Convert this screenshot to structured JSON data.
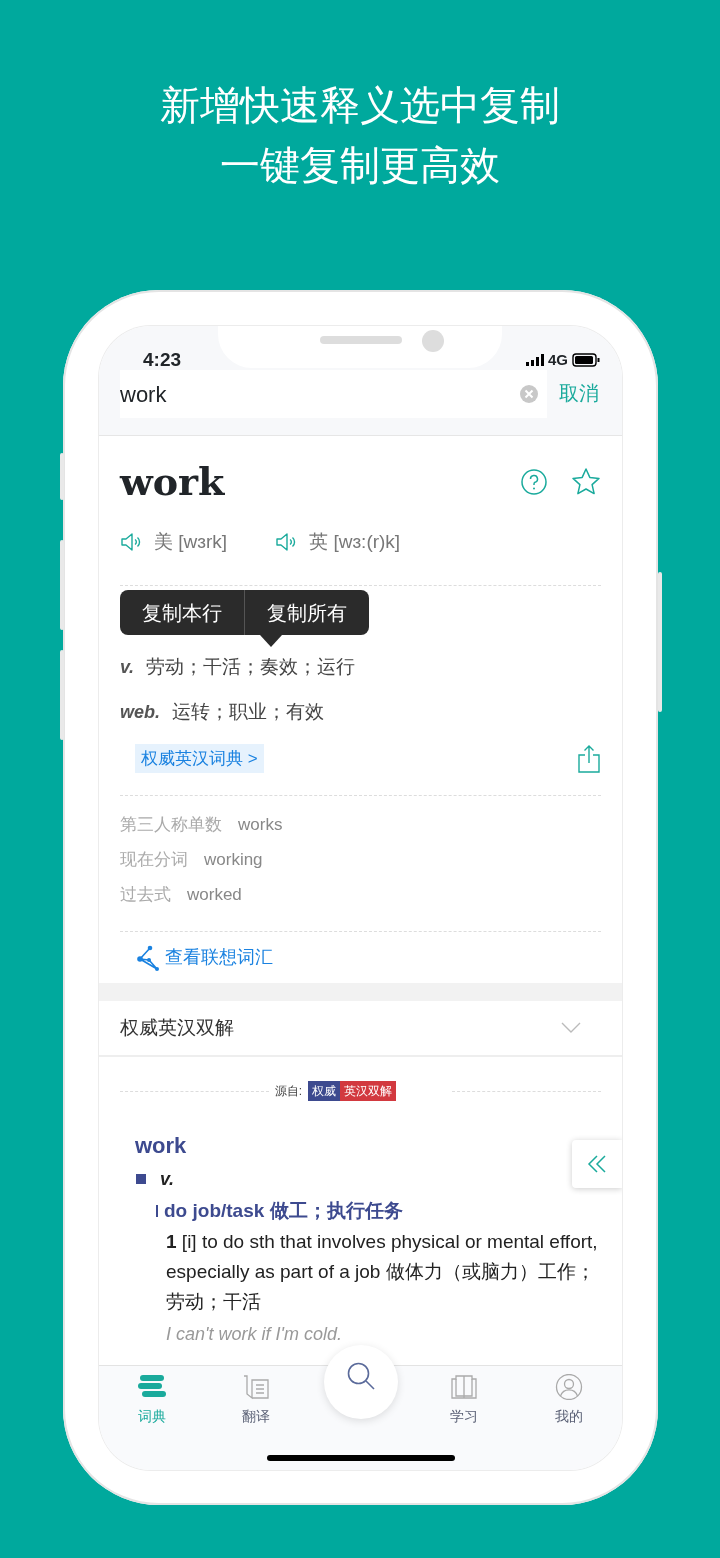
{
  "headline": [
    "新增快速释义选中复制",
    "一键复制更高效"
  ],
  "status_bar": {
    "time": "4:23",
    "network": "4G"
  },
  "search": {
    "value": "work",
    "cancel": "取消"
  },
  "entry": {
    "word": "work",
    "pronunciations": [
      {
        "label": "美",
        "phonetic": "[wɜrk]"
      },
      {
        "label": "英",
        "phonetic": "[wɜ:(r)k]"
      }
    ],
    "copy_menu": [
      "复制本行",
      "复制所有"
    ],
    "senses": [
      {
        "pos": "v.",
        "meaning": "劳动；干活；奏效；运行"
      },
      {
        "pos": "web.",
        "meaning": "运转；职业；有效"
      }
    ],
    "dict_link": "权威英汉词典 >",
    "forms": [
      {
        "label": "第三人称单数",
        "value": "works"
      },
      {
        "label": "现在分词",
        "value": "working"
      },
      {
        "label": "过去式",
        "value": "worked"
      }
    ],
    "related_link": "查看联想词汇"
  },
  "section": {
    "title": "权威英汉双解"
  },
  "source": {
    "label": "源自:",
    "tags": [
      {
        "text": "权威",
        "color": "#3d4a8f"
      },
      {
        "text": "英汉双解",
        "color": "#d2393f"
      }
    ]
  },
  "bilingual": {
    "word": "work",
    "pos": "v.",
    "sense_heading": "do job/task 做工；执行任务",
    "definition": "**1** [i] to do sth that involves physical or mental effort, especially as part of a job 做体力（或脑力）工作；劳动；干活",
    "example": "I can't work if I'm cold."
  },
  "tabs": [
    {
      "label": "词典",
      "kind": "dictionary",
      "selected": true
    },
    {
      "label": "翻译",
      "kind": "translate",
      "selected": false
    },
    {
      "label": "学习",
      "kind": "study",
      "selected": false
    },
    {
      "label": "我的",
      "kind": "profile",
      "selected": false
    }
  ]
}
